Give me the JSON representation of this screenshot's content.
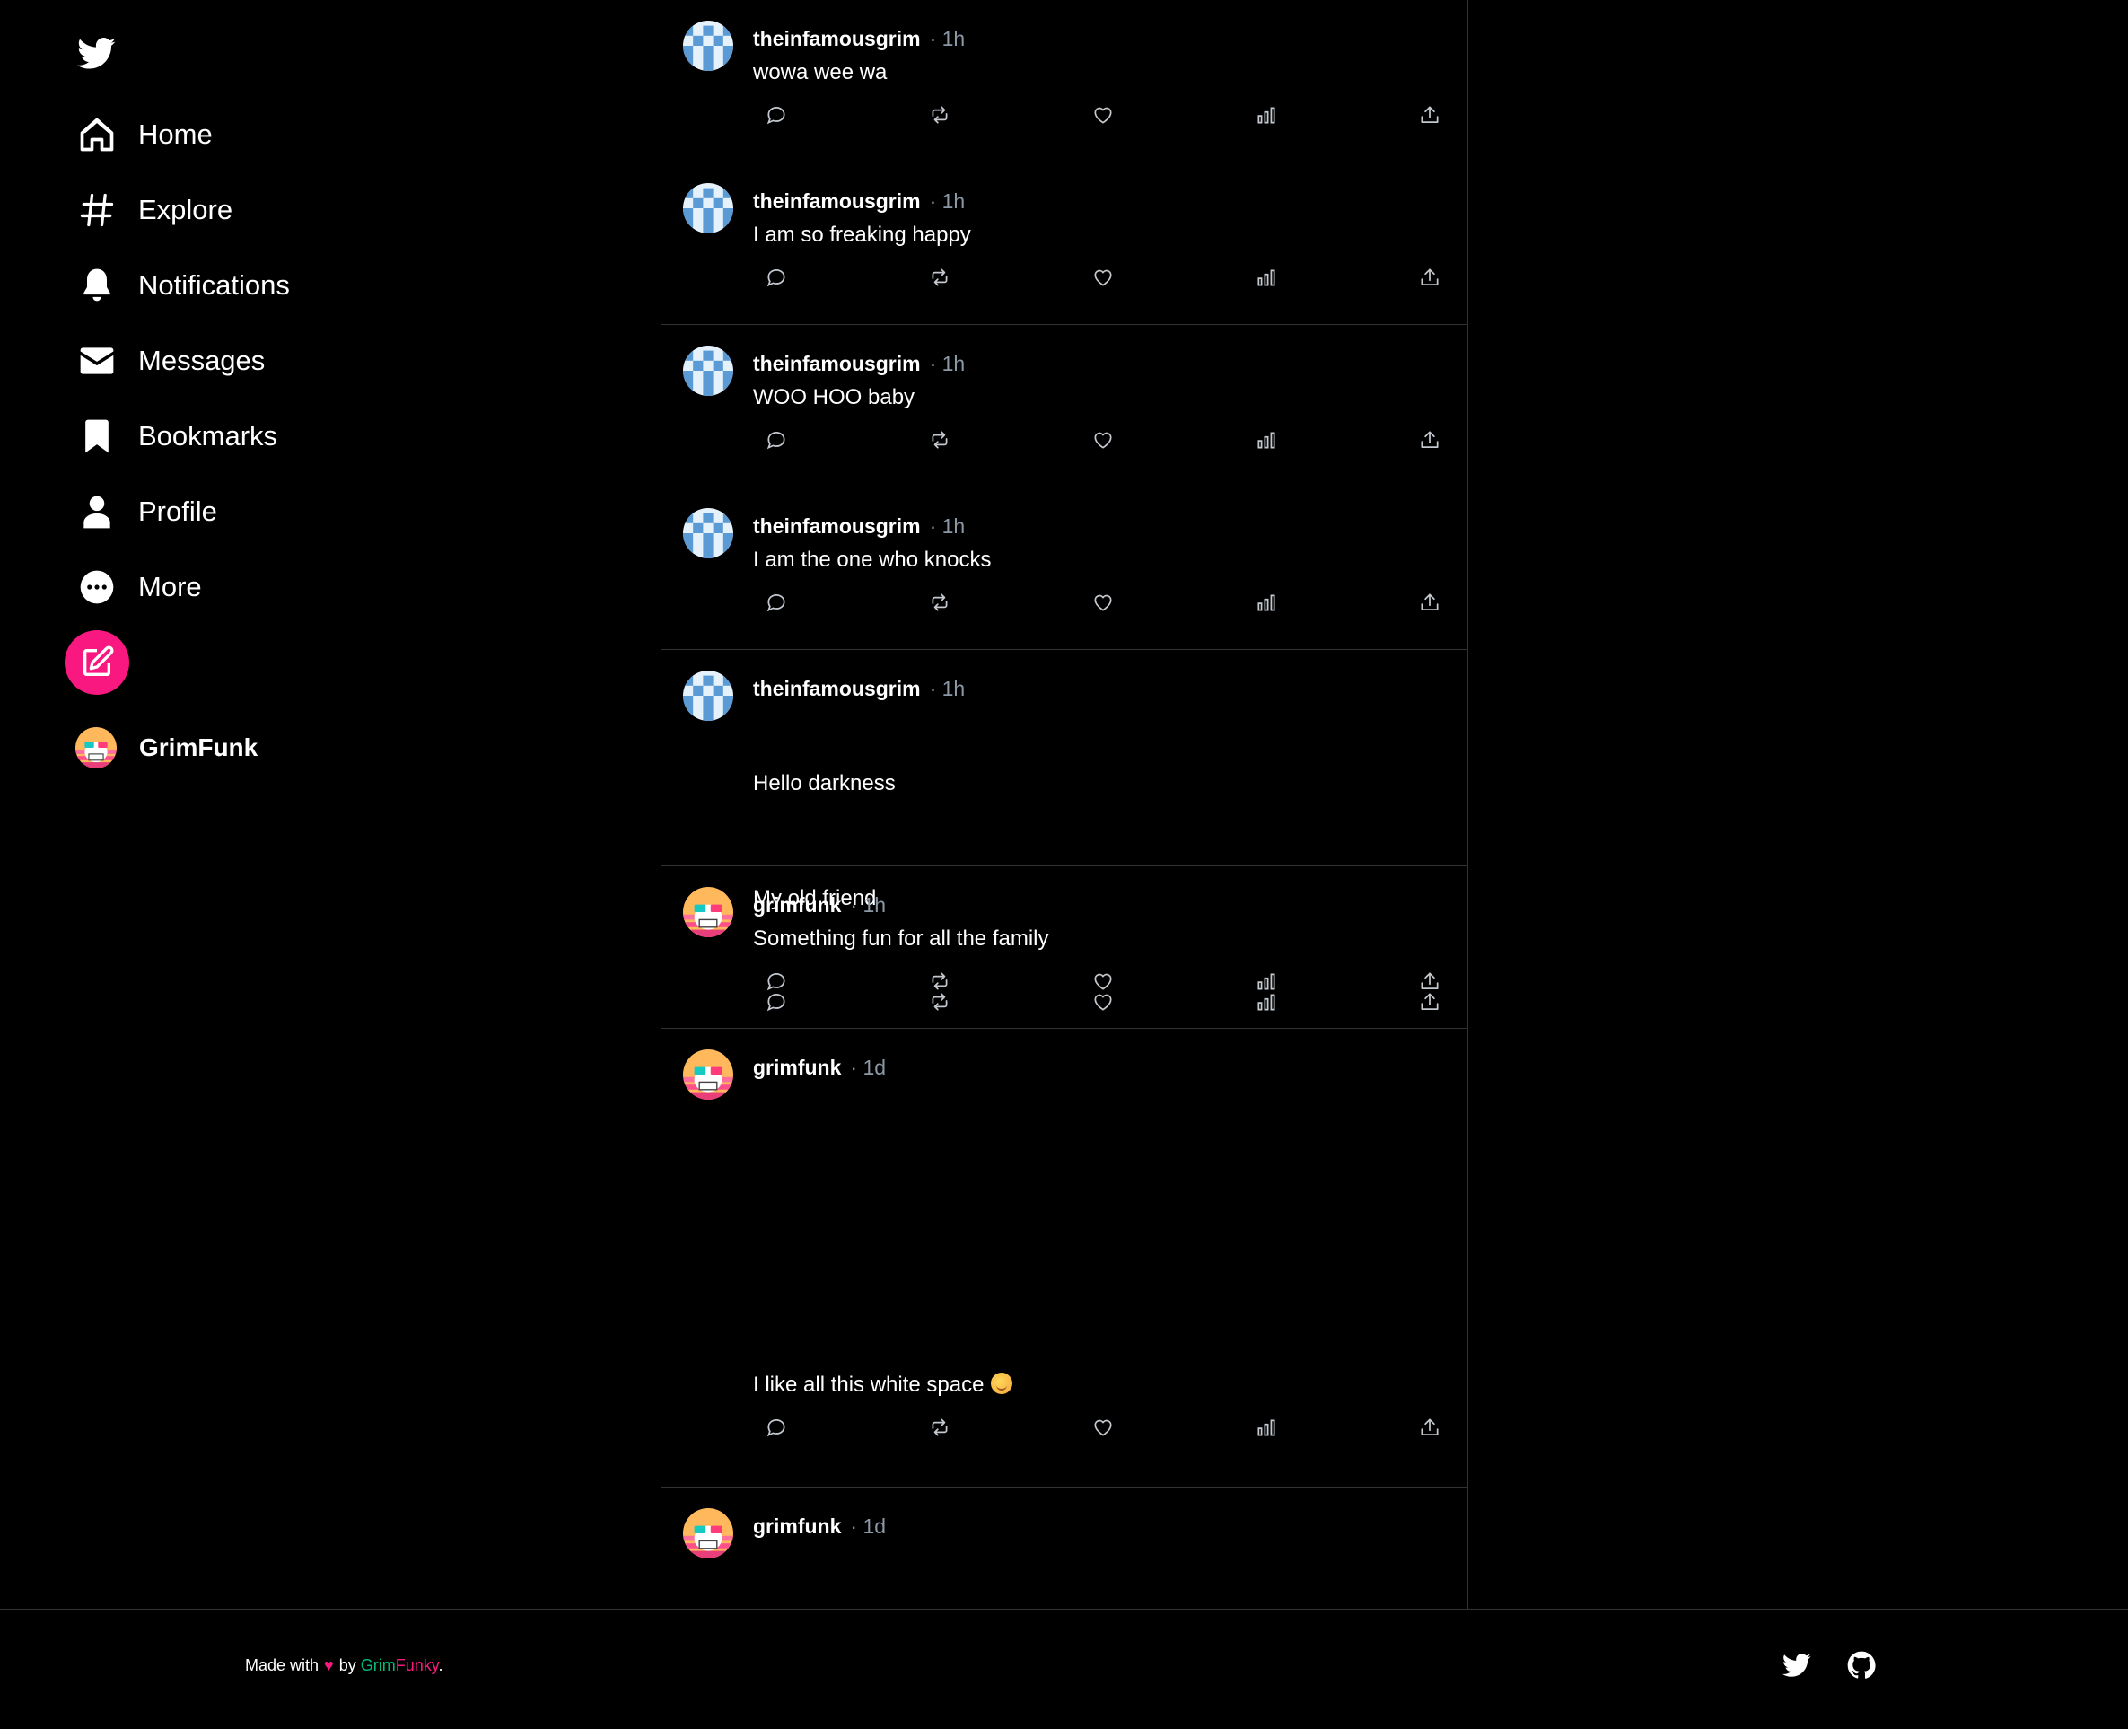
{
  "nav": {
    "items": [
      {
        "label": "Home",
        "icon": "home-icon"
      },
      {
        "label": "Explore",
        "icon": "hashtag-icon"
      },
      {
        "label": "Notifications",
        "icon": "bell-icon"
      },
      {
        "label": "Messages",
        "icon": "envelope-icon"
      },
      {
        "label": "Bookmarks",
        "icon": "bookmark-icon"
      },
      {
        "label": "Profile",
        "icon": "user-icon"
      },
      {
        "label": "More",
        "icon": "more-circle-icon"
      }
    ],
    "compose_icon": "compose-icon",
    "account_name": "GrimFunk"
  },
  "colors": {
    "background": "#000000",
    "accent": "#f91880",
    "secondary_text": "#8b98a5",
    "border": "#2f3336",
    "credit_green": "#00ba7c"
  },
  "feed": {
    "tweets": [
      {
        "handle": "theinfamousgrim",
        "time": "· 1h",
        "text": [
          "wowa wee wa"
        ]
      },
      {
        "handle": "theinfamousgrim",
        "time": "· 1h",
        "text": [
          "I am so freaking happy"
        ]
      },
      {
        "handle": "theinfamousgrim",
        "time": "· 1h",
        "text": [
          "WOO HOO baby"
        ]
      },
      {
        "handle": "theinfamousgrim",
        "time": "· 1h",
        "text": [
          "I am the one who knocks"
        ]
      },
      {
        "handle": "theinfamousgrim",
        "time": "· 1h",
        "text": [
          "Hello darkness",
          "My old friend"
        ]
      },
      {
        "handle": "grimfunk",
        "time": "· 1h",
        "text": [
          "Something fun for all the family"
        ]
      },
      {
        "handle": "grimfunk",
        "time": "· 1d",
        "text": [
          "I like all this white space"
        ]
      },
      {
        "handle": "grimfunk",
        "time": "· 1d",
        "text": []
      }
    ],
    "action_icons": [
      "reply-icon",
      "retweet-icon",
      "like-icon",
      "views-icon",
      "share-icon"
    ]
  },
  "footer": {
    "made_with": "Made with",
    "heart": "♥",
    "by": "by",
    "credit_a": "Grim",
    "credit_b": "Funky",
    "period": ".",
    "icons": [
      "twitter-icon",
      "github-icon"
    ]
  }
}
